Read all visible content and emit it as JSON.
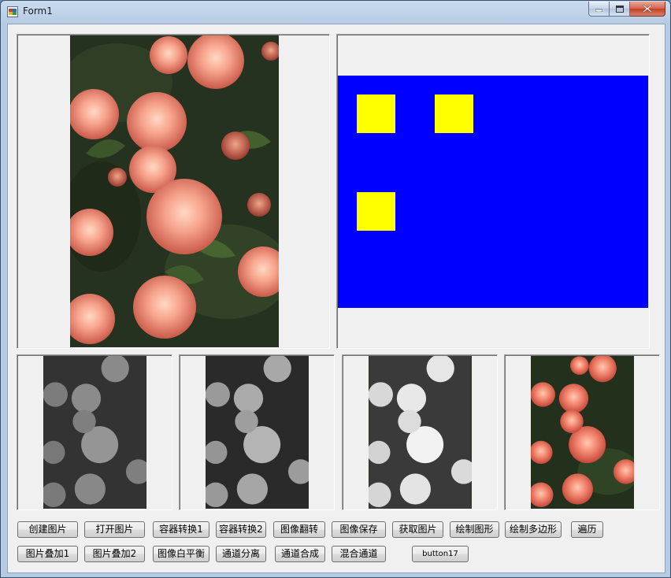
{
  "window": {
    "title": "Form1"
  },
  "buttons_row1": [
    "创建图片",
    "打开图片",
    "容器转换1",
    "容器转换2",
    "图像翻转",
    "图像保存",
    "获取图片",
    "绘制图形",
    "绘制多边形",
    "遍历"
  ],
  "buttons_row2": [
    "图片叠加1",
    "图片叠加2",
    "图像白平衡",
    "通道分离",
    "通道合成",
    "混合通道",
    "button17"
  ],
  "canvas": {
    "background": "#0000ff",
    "square_color": "#ffff00",
    "square_count": 3
  },
  "colors": {
    "form_bg": "#f0f0f0",
    "title_bar": "#b6cbe4",
    "close_button": "#c23d22"
  }
}
